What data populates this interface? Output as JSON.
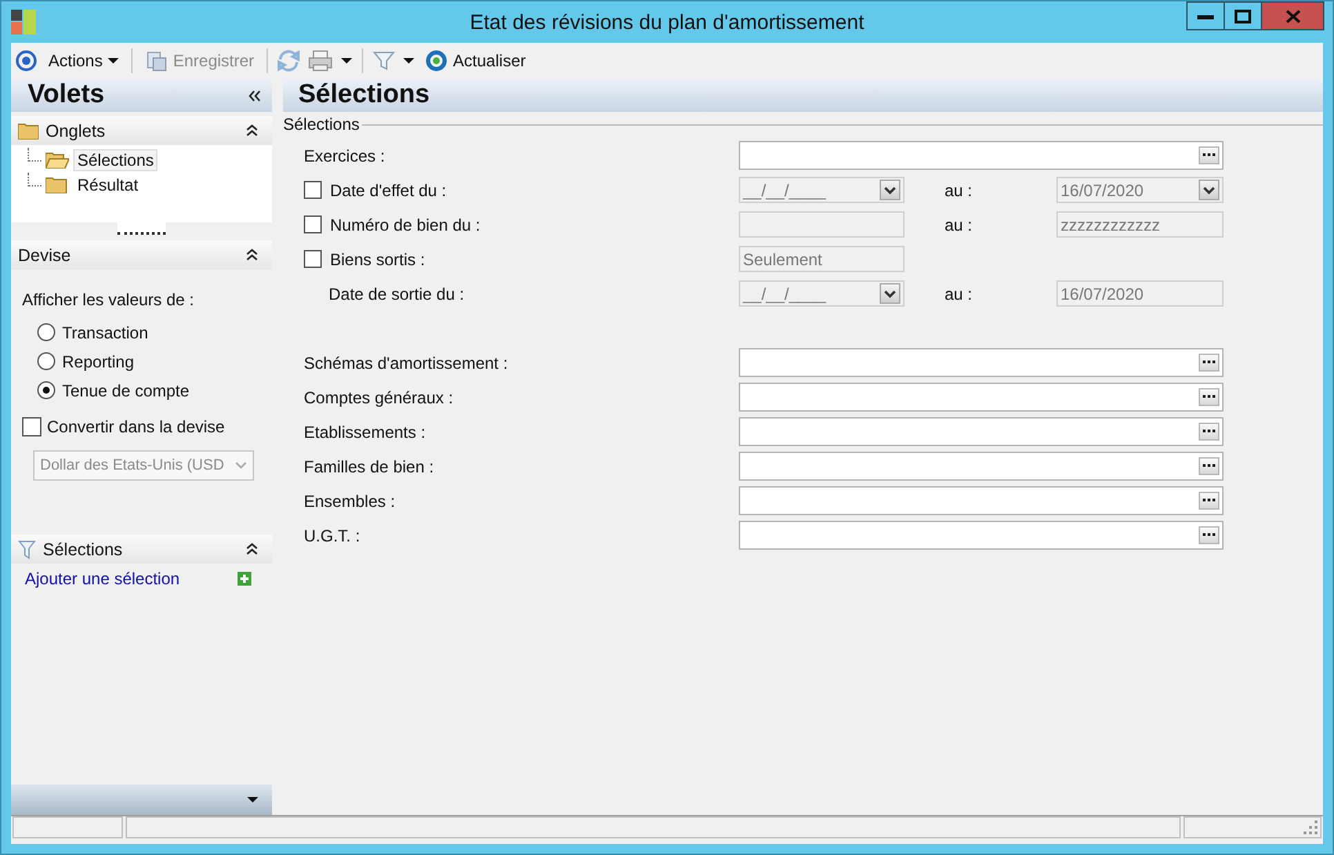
{
  "window": {
    "title": "Etat des révisions du plan d'amortissement"
  },
  "toolbar": {
    "actions": {
      "label": "Actions"
    },
    "save": {
      "label": "Enregistrer",
      "disabled": true
    },
    "refresh": {
      "label": "Actualiser"
    }
  },
  "panes": {
    "title": "Volets",
    "onglets": {
      "title": "Onglets",
      "expanded": true,
      "items": [
        {
          "label": "Sélections",
          "selected": true
        },
        {
          "label": "Résultat",
          "selected": false
        }
      ]
    },
    "devise": {
      "title": "Devise",
      "expanded": true,
      "prompt": "Afficher les valeurs de :",
      "options": [
        {
          "label": "Transaction",
          "selected": false
        },
        {
          "label": "Reporting",
          "selected": false
        },
        {
          "label": "Tenue de compte",
          "selected": true
        }
      ],
      "convert": {
        "label": "Convertir dans la devise",
        "checked": false
      },
      "currency": {
        "value": "Dollar des Etats-Unis (USD",
        "disabled": true
      }
    },
    "selections": {
      "title": "Sélections",
      "expanded": true,
      "link": "Ajouter une sélection"
    }
  },
  "main": {
    "title": "Sélections",
    "group": "Sélections",
    "rows": [
      {
        "kind": "lookup",
        "label": "Exercices :"
      },
      {
        "kind": "range",
        "checked": false,
        "label": "Date d'effet du :",
        "from": {
          "kind": "date",
          "value": "__/__/____",
          "disabled": true
        },
        "to_label": "au :",
        "to": {
          "kind": "date",
          "value": "16/07/2020",
          "disabled": true
        }
      },
      {
        "kind": "range",
        "checked": false,
        "label": "Numéro de bien du :",
        "from": {
          "kind": "text",
          "disabled": true
        },
        "to_label": "au :",
        "to": {
          "kind": "text",
          "value": "zzzzzzzzzzzz",
          "disabled": true
        }
      },
      {
        "kind": "range",
        "checked": false,
        "label": "Biens sortis :",
        "from": {
          "kind": "text",
          "value": "Seulement",
          "disabled": true
        }
      },
      {
        "kind": "subrange",
        "label": "Date de sortie du :",
        "from": {
          "kind": "date",
          "value": "__/__/____",
          "disabled": true
        },
        "to_label": "au :",
        "to": {
          "kind": "text",
          "value": "16/07/2020",
          "disabled": true
        }
      },
      {
        "kind": "spacer"
      },
      {
        "kind": "lookup",
        "label": "Schémas d'amortissement :"
      },
      {
        "kind": "lookup",
        "label": "Comptes généraux :"
      },
      {
        "kind": "lookup",
        "label": "Etablissements :"
      },
      {
        "kind": "lookup",
        "label": "Familles de bien :"
      },
      {
        "kind": "lookup",
        "label": "Ensembles :"
      },
      {
        "kind": "lookup",
        "label": "U.G.T. :"
      }
    ]
  }
}
